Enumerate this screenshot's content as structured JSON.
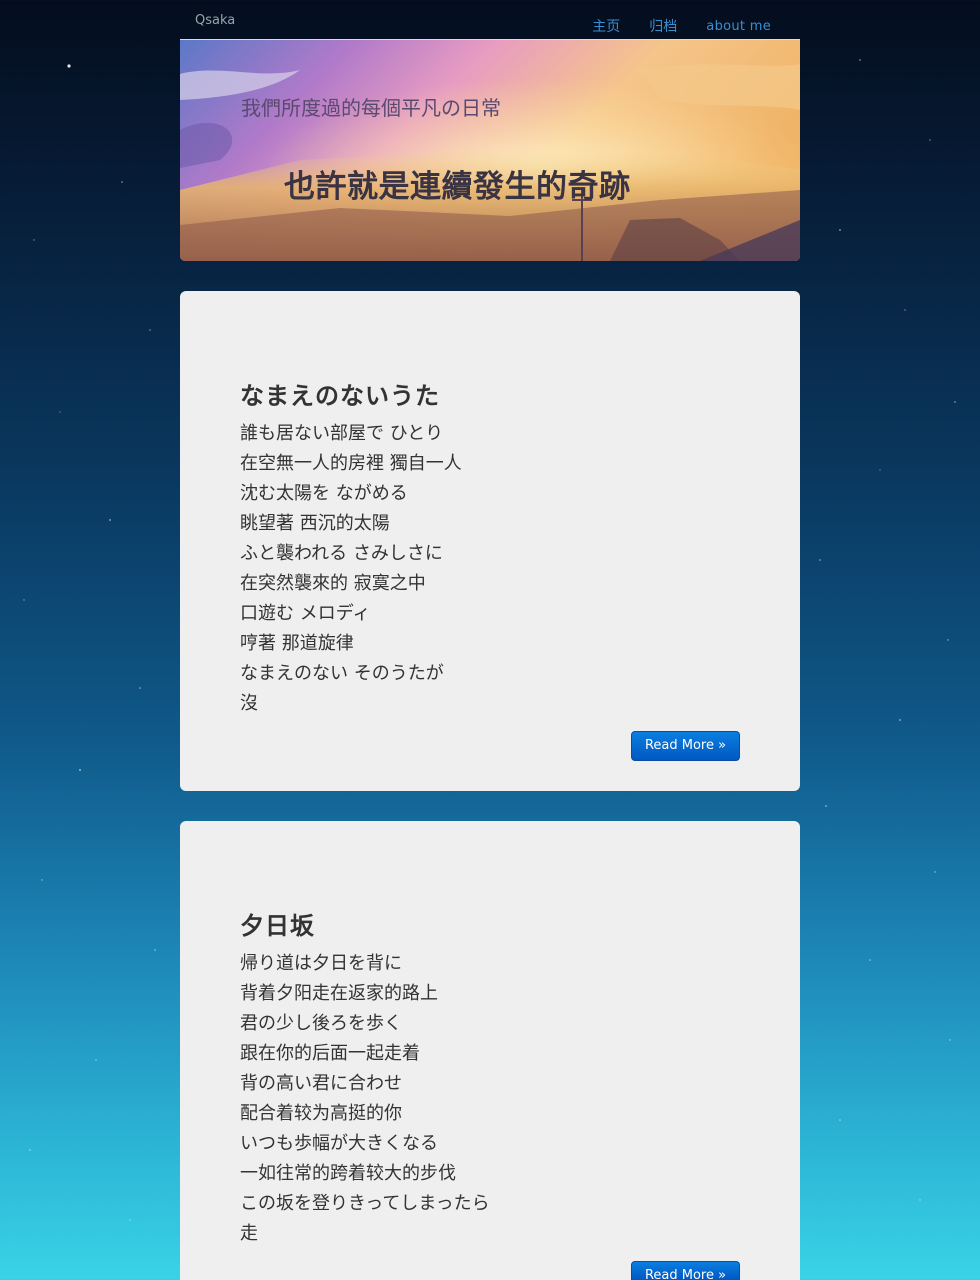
{
  "site": {
    "brand": "Qsaka",
    "nav": [
      {
        "label": "主页"
      },
      {
        "label": "归档"
      },
      {
        "label": "about me"
      }
    ]
  },
  "hero": {
    "subtitle": "我們所度過的每個平凡の日常",
    "title": "也許就是連續發生的奇跡"
  },
  "posts": [
    {
      "title": "なまえのないうた",
      "lines": [
        "誰も居ない部屋で ひとり",
        "在空無一人的房裡 獨自一人",
        "沈む太陽を ながめる",
        "眺望著 西沉的太陽",
        "ふと襲われる さみしさに",
        "在突然襲來的 寂寞之中",
        "口遊む メロディ",
        "哼著 那道旋律",
        "なまえのない そのうたが",
        "沒"
      ],
      "read_more": "Read More »"
    },
    {
      "title": "夕日坂",
      "lines": [
        "帰り道は夕日を背に",
        "背着夕阳走在返家的路上",
        "君の少し後ろを歩く",
        "跟在你的后面一起走着",
        "背の高い君に合わせ",
        "配合着较为高挺的你",
        "いつも歩幅が大きくなる",
        "一如往常的跨着较大的步伐",
        "この坂を登りきってしまったら",
        "走"
      ],
      "read_more": "Read More »"
    }
  ],
  "colors": {
    "link": "#3a8fd0",
    "button": "#0069d2",
    "card_bg": "#efefef"
  }
}
